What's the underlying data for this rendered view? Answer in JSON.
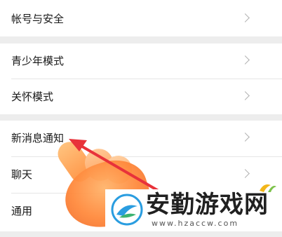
{
  "settings": {
    "items": [
      {
        "label": "帐号与安全"
      },
      {
        "label": "青少年模式"
      },
      {
        "label": "关怀模式"
      },
      {
        "label": "新消息通知"
      },
      {
        "label": "聊天"
      },
      {
        "label": "通用"
      }
    ]
  },
  "overlay": {
    "arrow_color": "#e8323a",
    "hand_color": "#ff8a3d"
  },
  "watermark": {
    "title": "安勤游戏网",
    "url": "www.hzaccw.com"
  }
}
